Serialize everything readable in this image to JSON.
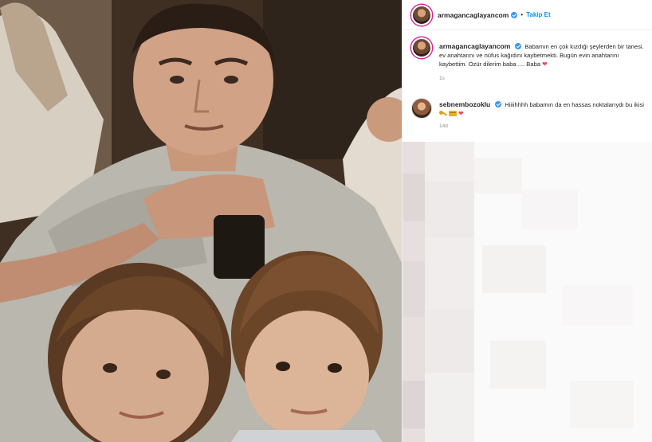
{
  "header": {
    "username": "armagancaglayancom",
    "separator": "•",
    "follow_label": "Takip Et"
  },
  "caption": {
    "username": "armagancaglayancom",
    "text": "Babamın en çok kızdığı şeylerden bir tanesi. ev anahtarını ve nüfus kağıdını kaybetmekti. Bugün evin anahtarını kaybettim. Özür dilerim baba .... Baba",
    "heart": "❤",
    "time": "1s"
  },
  "reply": {
    "username": "sebnembozoklu",
    "text": "Hiiiihhhh babamın da en hassas noktalarıydı bu ikisi",
    "heart": "❤",
    "time": "14d"
  },
  "colors": {
    "link": "#0095f6",
    "verified": "#3897f0",
    "heart": "#ed4956",
    "muted": "#8e8e8e"
  },
  "icons": [
    "verified-badge-icon",
    "key-emoji-icon",
    "id-card-emoji-icon",
    "heart-icon"
  ]
}
